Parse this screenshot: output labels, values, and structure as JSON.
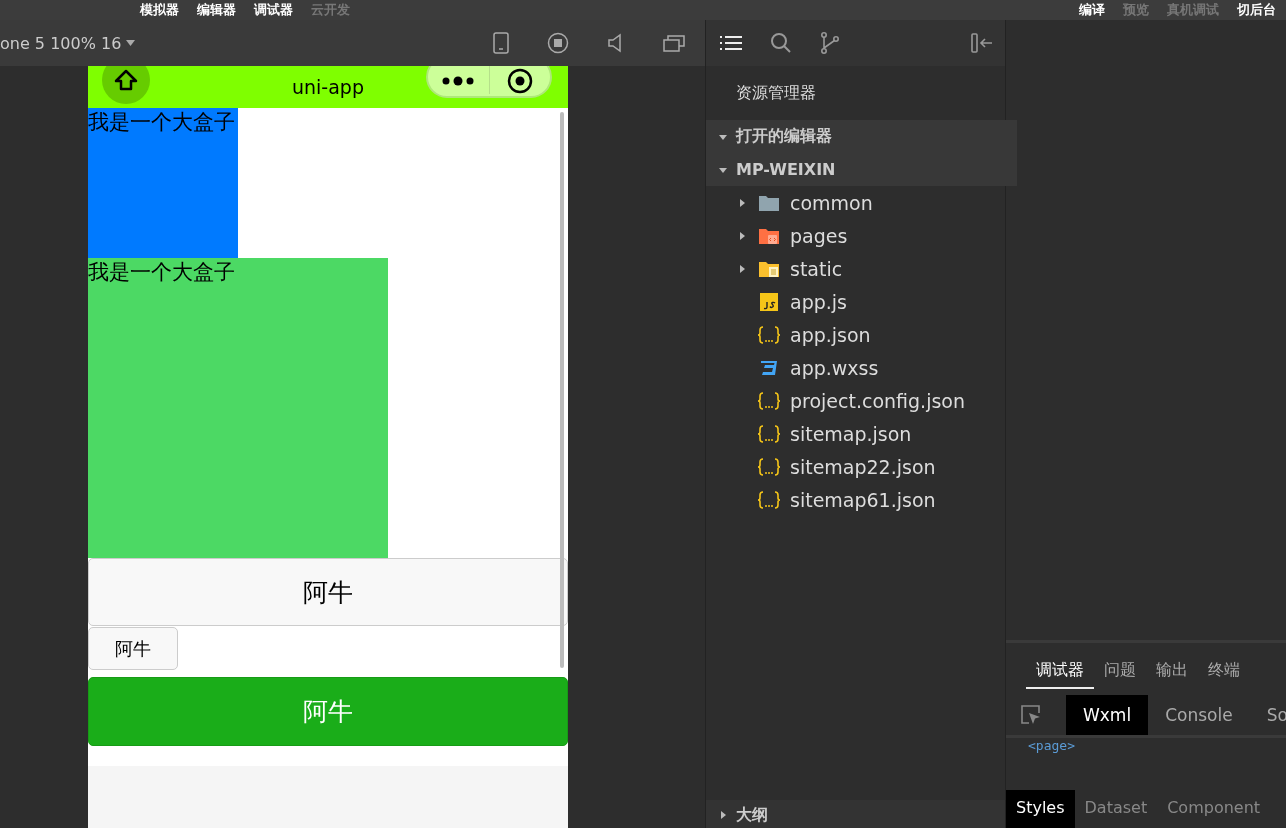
{
  "menu_left": [
    {
      "label": "模拟器",
      "disabled": false
    },
    {
      "label": "编辑器",
      "disabled": false
    },
    {
      "label": "调试器",
      "disabled": false
    },
    {
      "label": "云开发",
      "disabled": true
    }
  ],
  "menu_right": [
    {
      "label": "编译",
      "disabled": false
    },
    {
      "label": "预览",
      "disabled": true
    },
    {
      "label": "真机调试",
      "disabled": true
    },
    {
      "label": "切后台",
      "disabled": false
    }
  ],
  "simulator": {
    "device": "one 5 100% 16",
    "nav_title": "uni-app",
    "boxes": [
      {
        "text": "我是一个大盒子",
        "kind": "small",
        "color": "#007aff"
      },
      {
        "text": "我是一个大盒子",
        "kind": "large",
        "color": "#4cd964"
      }
    ],
    "buttons": [
      {
        "label": "阿牛",
        "kind": "default"
      },
      {
        "label": "阿牛",
        "kind": "mini"
      },
      {
        "label": "阿牛",
        "kind": "primary"
      }
    ]
  },
  "explorer": {
    "title": "资源管理器",
    "sections": [
      {
        "label": "打开的编辑器",
        "expanded": true
      },
      {
        "label": "MP-WEIXIN",
        "expanded": true
      }
    ],
    "files": [
      {
        "name": "common",
        "kind": "folder",
        "expanded": false
      },
      {
        "name": "pages",
        "kind": "pages-folder",
        "expanded": false
      },
      {
        "name": "static",
        "kind": "static-folder",
        "expanded": false
      },
      {
        "name": "app.js",
        "kind": "js"
      },
      {
        "name": "app.json",
        "kind": "json"
      },
      {
        "name": "app.wxss",
        "kind": "css"
      },
      {
        "name": "project.config.json",
        "kind": "json"
      },
      {
        "name": "sitemap.json",
        "kind": "json"
      },
      {
        "name": "sitemap22.json",
        "kind": "json"
      },
      {
        "name": "sitemap61.json",
        "kind": "json"
      }
    ],
    "outline": {
      "label": "大纲",
      "expanded": false
    }
  },
  "debugger": {
    "tabs": [
      {
        "label": "调试器",
        "selected": true
      },
      {
        "label": "问题",
        "selected": false
      },
      {
        "label": "输出",
        "selected": false
      },
      {
        "label": "终端",
        "selected": false
      }
    ],
    "panels": [
      {
        "label": "Wxml",
        "selected": true
      },
      {
        "label": "Console",
        "selected": false
      },
      {
        "label": "So",
        "selected": false
      }
    ],
    "node": "<page>",
    "style_tabs": [
      {
        "label": "Styles",
        "selected": true
      },
      {
        "label": "Dataset",
        "selected": false
      },
      {
        "label": "Component",
        "selected": false
      }
    ]
  }
}
